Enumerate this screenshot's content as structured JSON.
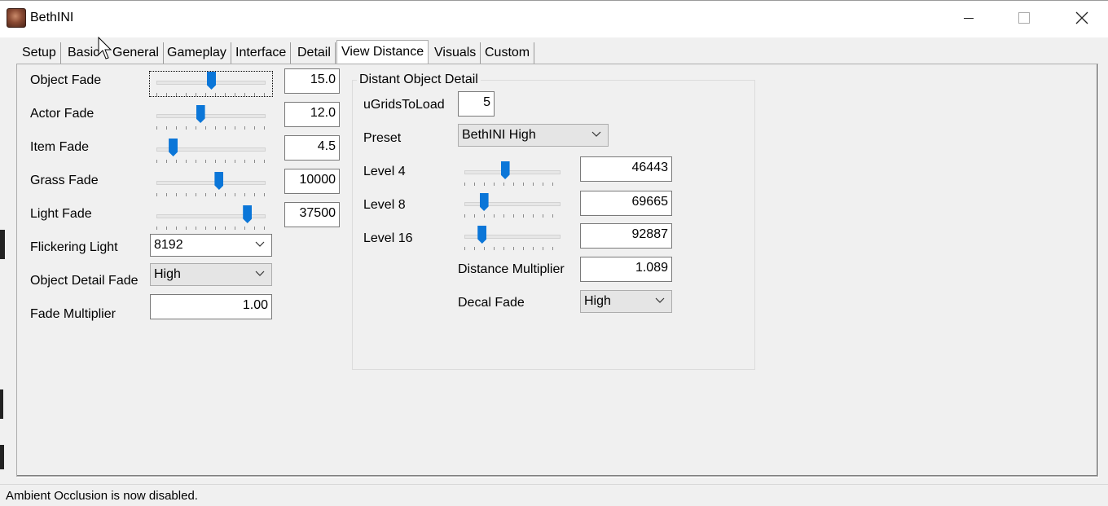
{
  "window": {
    "title": "BethINI",
    "minimize_icon": "minimize-icon",
    "maximize_icon": "maximize-icon",
    "close_icon": "close-icon"
  },
  "tabs": [
    {
      "label": "Setup"
    },
    {
      "label": "Basic"
    },
    {
      "label": "General"
    },
    {
      "label": "Gameplay"
    },
    {
      "label": "Interface"
    },
    {
      "label": "Detail"
    },
    {
      "label": "View Distance",
      "active": true
    },
    {
      "label": "Visuals"
    },
    {
      "label": "Custom"
    }
  ],
  "left": {
    "object_fade": {
      "label": "Object Fade",
      "value": "15.0",
      "slider_fraction": 0.5
    },
    "actor_fade": {
      "label": "Actor Fade",
      "value": "12.0",
      "slider_fraction": 0.4
    },
    "item_fade": {
      "label": "Item Fade",
      "value": "4.5",
      "slider_fraction": 0.15
    },
    "grass_fade": {
      "label": "Grass Fade",
      "value": "10000",
      "slider_fraction": 0.57
    },
    "light_fade": {
      "label": "Light Fade",
      "value": "37500",
      "slider_fraction": 0.83
    },
    "flickering_light": {
      "label": "Flickering Light",
      "value": "8192"
    },
    "object_detail_fade": {
      "label": "Object Detail Fade",
      "value": "High"
    },
    "fade_multiplier": {
      "label": "Fade Multiplier",
      "value": "1.00"
    }
  },
  "distant": {
    "title": "Distant Object Detail",
    "ugrids": {
      "label": "uGridsToLoad",
      "value": "5"
    },
    "preset": {
      "label": "Preset",
      "value": "BethINI High"
    },
    "level4": {
      "label": "Level 4",
      "value": "46443",
      "slider_fraction": 0.42
    },
    "level8": {
      "label": "Level 8",
      "value": "69665",
      "slider_fraction": 0.2
    },
    "level16": {
      "label": "Level 16",
      "value": "92887",
      "slider_fraction": 0.18
    },
    "distance_multiplier": {
      "label": "Distance Multiplier",
      "value": "1.089"
    },
    "decal_fade": {
      "label": "Decal Fade",
      "value": "High"
    }
  },
  "status": {
    "text": "Ambient Occlusion is now disabled."
  },
  "colors": {
    "accent": "#0b76d8",
    "window_bg": "#f0f0f0"
  }
}
